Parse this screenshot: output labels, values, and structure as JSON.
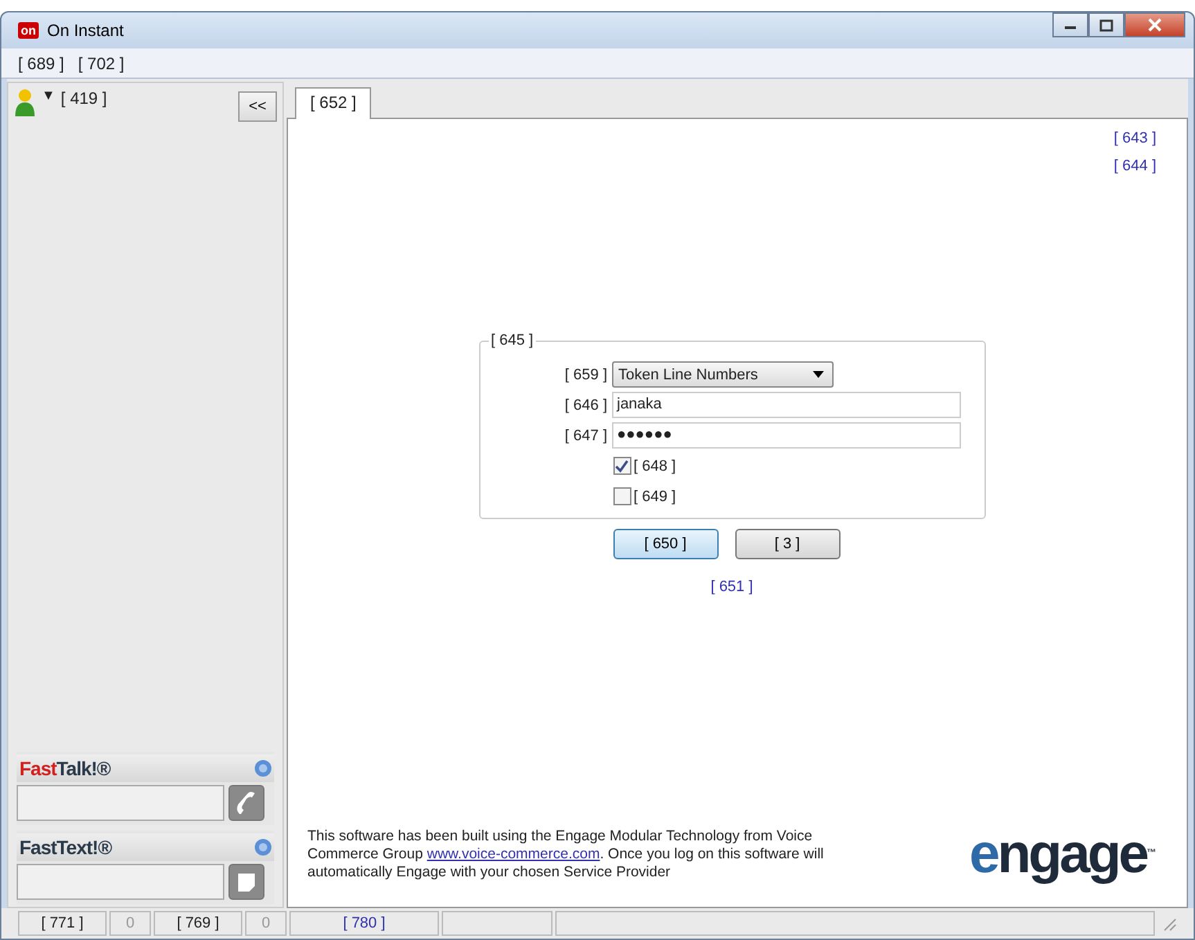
{
  "window": {
    "title": "On Instant",
    "app_icon_text": "on"
  },
  "menu": [
    {
      "label": "[ 689 ]"
    },
    {
      "label": "[ 702 ]"
    }
  ],
  "sidebar": {
    "user": "[ 419 ]",
    "dropdown_glyph": "▼",
    "collapse_button": "<<",
    "fasttalk": {
      "title_lead": "Fast",
      "title_rest": "Talk!®"
    },
    "fasttext": {
      "title_rest": "FastText!®"
    }
  },
  "tabs": [
    {
      "label": "[ 652 ]",
      "selected": true
    }
  ],
  "top_links": [
    "[ 643 ]",
    "[ 644 ]"
  ],
  "form": {
    "legend": "[ 645 ]",
    "fields": [
      {
        "kind": "select",
        "label": "[ 659 ]",
        "value": "Token Line Numbers"
      },
      {
        "kind": "text",
        "label": "[ 646 ]",
        "value": "janaka"
      },
      {
        "kind": "text",
        "label": "[ 647 ]",
        "value": "●●●●●●"
      }
    ],
    "checkboxes": [
      {
        "label": "[ 648 ]",
        "checked": true
      },
      {
        "label": "[ 649 ]",
        "checked": false
      }
    ]
  },
  "buttons": [
    {
      "label": "[ 650 ]",
      "default": true
    },
    {
      "label": "[ 3 ]",
      "default": false
    }
  ],
  "link": "[ 651 ]",
  "footer": {
    "before": "This software has been built using the Engage Modular Technology from Voice Commerce Group ",
    "link": "www.voice-commerce.com",
    "after": ". Once you log on this software will automatically Engage with your chosen Service Provider"
  },
  "logo": {
    "lead": "e",
    "rest": "ngage",
    "mark": "™"
  },
  "status_bar": [
    {
      "text": "[ 771 ]",
      "kind": "label"
    },
    {
      "text": "0",
      "kind": "count"
    },
    {
      "text": "[ 769 ]",
      "kind": "label"
    },
    {
      "text": "0",
      "kind": "count"
    },
    {
      "text": "[ 780 ]",
      "kind": "link"
    },
    {
      "kind": "empty"
    },
    {
      "kind": "empty"
    }
  ]
}
